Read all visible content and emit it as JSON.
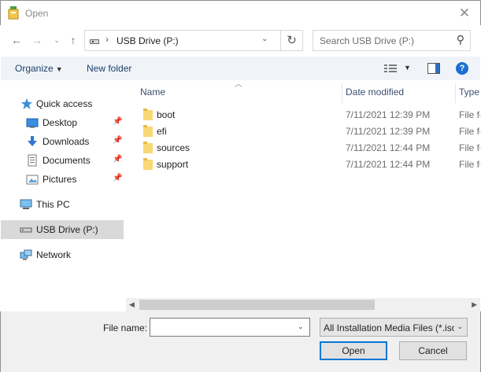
{
  "window": {
    "title": "Open"
  },
  "address_bar": {
    "location": "USB Drive (P:)"
  },
  "search": {
    "placeholder": "Search USB Drive (P:)"
  },
  "toolbar": {
    "organize_label": "Organize",
    "new_folder_label": "New folder"
  },
  "sidebar": {
    "items": [
      {
        "label": "Quick access",
        "icon": "star-icon"
      },
      {
        "label": "Desktop",
        "icon": "desktop-icon",
        "pinned": true
      },
      {
        "label": "Downloads",
        "icon": "download-icon",
        "pinned": true
      },
      {
        "label": "Documents",
        "icon": "document-icon",
        "pinned": true
      },
      {
        "label": "Pictures",
        "icon": "pictures-icon",
        "pinned": true
      },
      {
        "label": "This PC",
        "icon": "computer-icon"
      },
      {
        "label": "USB Drive (P:)",
        "icon": "usb-drive-icon",
        "selected": true
      },
      {
        "label": "Network",
        "icon": "network-icon"
      }
    ]
  },
  "file_list": {
    "columns": [
      "Name",
      "Date modified",
      "Type"
    ],
    "rows": [
      {
        "name": "boot",
        "date": "7/11/2021 12:39 PM",
        "type": "File folder"
      },
      {
        "name": "efi",
        "date": "7/11/2021 12:39 PM",
        "type": "File folder"
      },
      {
        "name": "sources",
        "date": "7/11/2021 12:44 PM",
        "type": "File folder"
      },
      {
        "name": "support",
        "date": "7/11/2021 12:44 PM",
        "type": "File folder"
      }
    ]
  },
  "footer": {
    "file_name_label": "File name:",
    "file_name_value": "",
    "filter_value": "All Installation Media Files (*.iso)",
    "open_label": "Open",
    "cancel_label": "Cancel"
  },
  "colors": {
    "accent": "#0078d7",
    "folder": "#f8d775",
    "selection": "#d9d9d9"
  }
}
